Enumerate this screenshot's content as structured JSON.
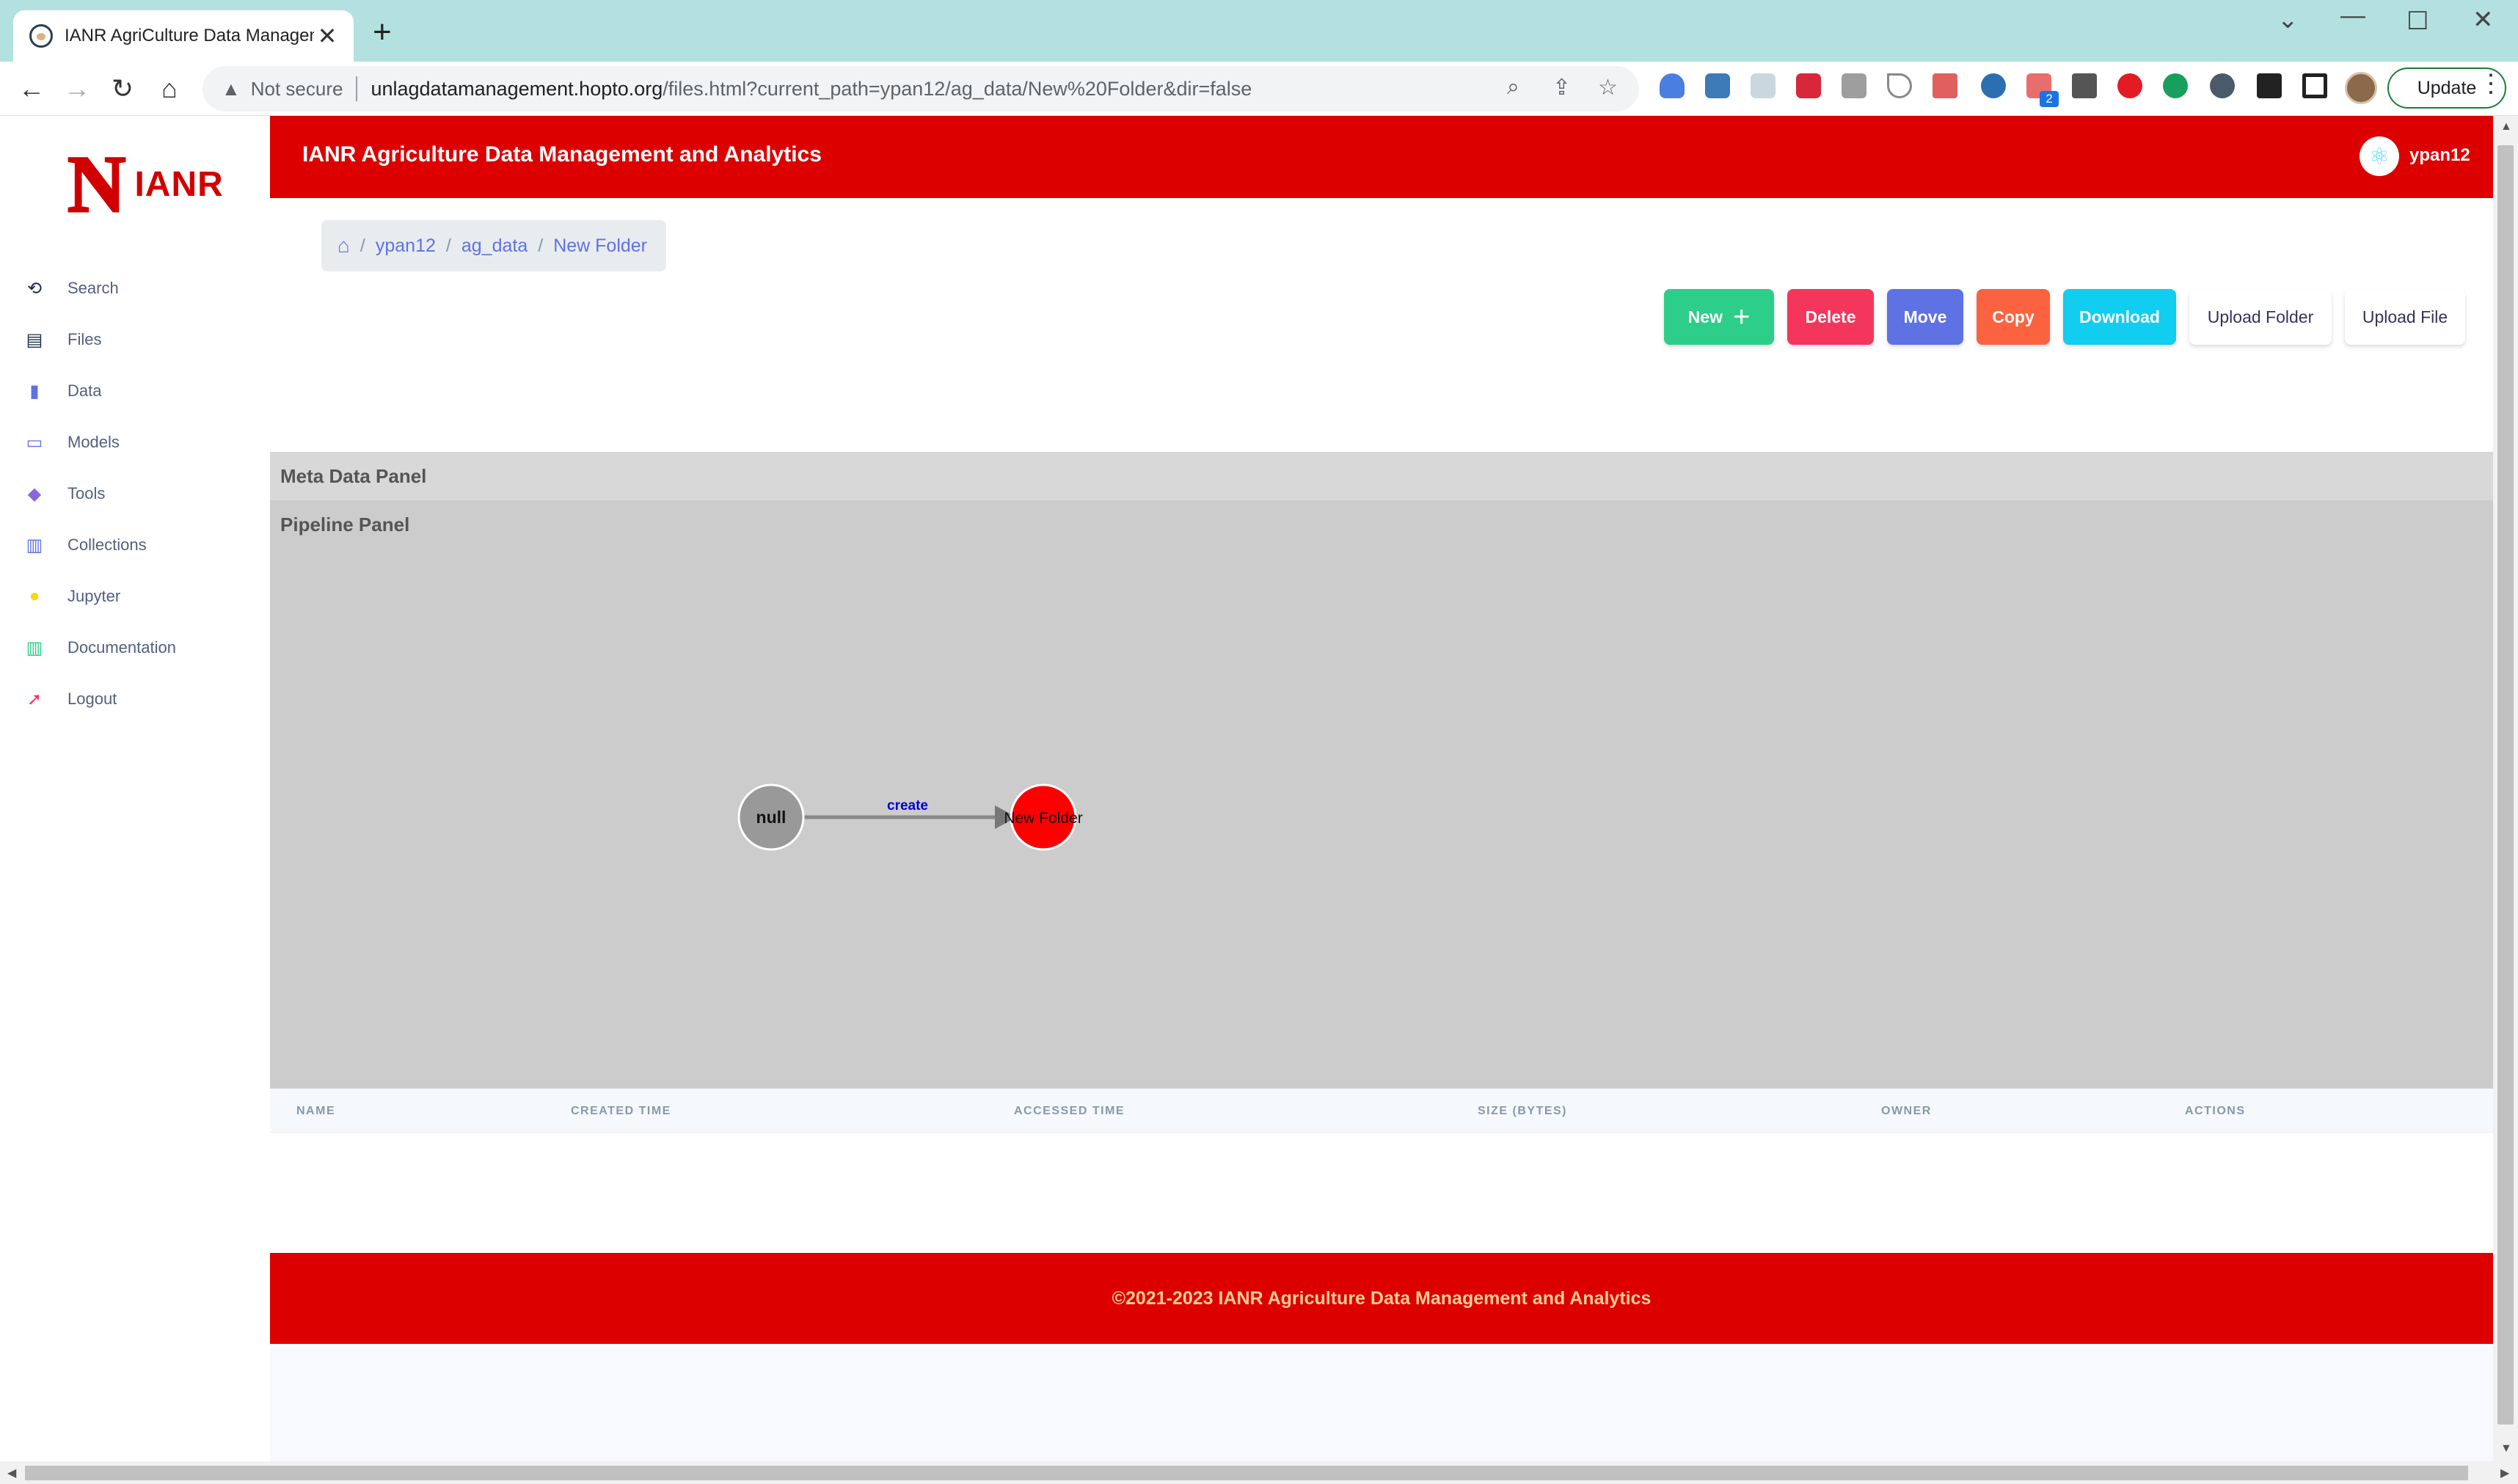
{
  "browser": {
    "tab_title": "IANR AgriCulture Data Managemen",
    "tab_close": "✕",
    "new_tab": "+",
    "window_controls": {
      "minimize": "⌄",
      "restore": "—",
      "maximize": "☐",
      "close": "✕"
    },
    "not_secure": "Not secure",
    "url_host": "unlagdatamanagement.hopto.org",
    "url_rest": "/files.html?current_path=ypan12/ag_data/New%20Folder&dir=false",
    "update_label": "Update",
    "extension_badge": "2"
  },
  "app": {
    "logo_n": "N",
    "logo_text": "IANR",
    "title": "IANR Agriculture Data Management and Analytics",
    "user": "ypan12"
  },
  "sidebar": {
    "items": [
      {
        "label": "Search",
        "icon": "search-icon",
        "color": "#172b4d"
      },
      {
        "label": "Files",
        "icon": "files-icon",
        "color": "#172b4d"
      },
      {
        "label": "Data",
        "icon": "chart-icon",
        "color": "#5e72e4"
      },
      {
        "label": "Models",
        "icon": "laptop-icon",
        "color": "#5e72e4"
      },
      {
        "label": "Tools",
        "icon": "cube-icon",
        "color": "#8965e0"
      },
      {
        "label": "Collections",
        "icon": "collections-icon",
        "color": "#5e72e4"
      },
      {
        "label": "Jupyter",
        "icon": "user-icon",
        "color": "#ffd600"
      },
      {
        "label": "Documentation",
        "icon": "books-icon",
        "color": "#2dce89"
      },
      {
        "label": "Logout",
        "icon": "logout-icon",
        "color": "#f5365c"
      }
    ]
  },
  "breadcrumb": {
    "items": [
      "ypan12",
      "ag_data",
      "New Folder"
    ],
    "separator": "/"
  },
  "actions": {
    "new": "New",
    "new_plus": "+",
    "delete": "Delete",
    "move": "Move",
    "copy": "Copy",
    "download": "Download",
    "upload_folder": "Upload Folder",
    "upload_file": "Upload File"
  },
  "colors": {
    "brand_red": "#dc0000",
    "new": "#2dce89",
    "delete": "#f5365c",
    "move": "#5e72e4",
    "copy": "#fb6340",
    "download": "#11cdef"
  },
  "panels": {
    "meta": "Meta Data Panel",
    "pipeline": "Pipeline Panel"
  },
  "pipeline_graph": {
    "nodes": [
      {
        "label": "null",
        "color": "#999999"
      },
      {
        "label": "New Folder",
        "color": "#ff0000"
      }
    ],
    "edge": {
      "label": "create",
      "color": "#0000cc"
    }
  },
  "table": {
    "headers": [
      "NAME",
      "CREATED TIME",
      "ACCESSED TIME",
      "SIZE (BYTES)",
      "OWNER",
      "ACTIONS"
    ],
    "rows": []
  },
  "footer": {
    "text": "©2021-2023 IANR Agriculture Data Management and Analytics"
  }
}
